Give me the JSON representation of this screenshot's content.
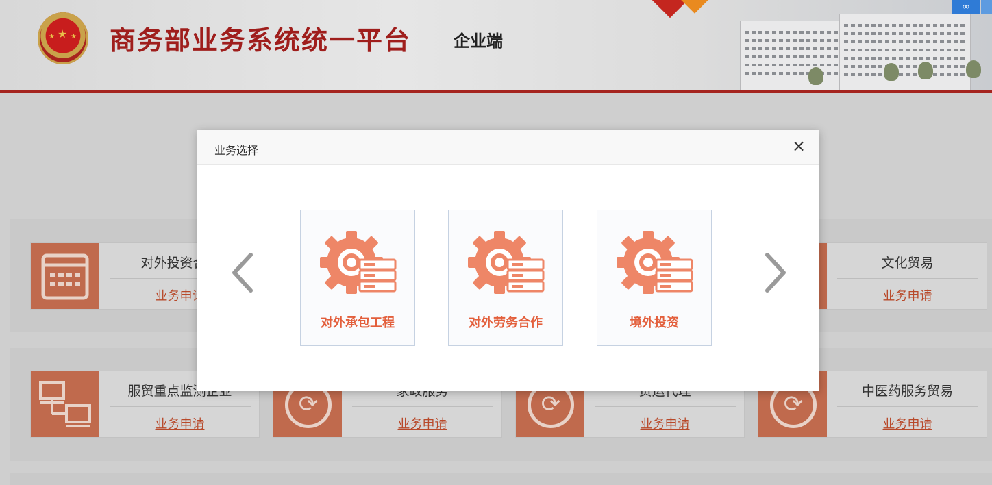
{
  "header": {
    "title": "商务部业务系统统一平台",
    "subtitle": "企业端",
    "badge_icon": "baidu-cloud-icon"
  },
  "background_cards": [
    {
      "name": "对外投资合作",
      "apply": "业务申请",
      "icon": "calendar-icon"
    },
    {
      "name": "文化贸易",
      "apply": "业务申请",
      "icon": "gear-icon"
    },
    {
      "name": "服贸重点监测企业",
      "apply": "业务申请",
      "icon": "network-icon"
    },
    {
      "name": "家政服务",
      "apply": "业务申请",
      "icon": "refresh-icon"
    },
    {
      "name": "货运代理",
      "apply": "业务申请",
      "icon": "refresh-icon"
    },
    {
      "name": "中医药服务贸易",
      "apply": "业务申请",
      "icon": "refresh-icon"
    }
  ],
  "modal": {
    "title": "业务选择",
    "close_icon": "×",
    "prev_icon": "chevron-left-icon",
    "next_icon": "chevron-right-icon",
    "options": [
      {
        "label": "对外承包工程",
        "icon": "gear-server-icon"
      },
      {
        "label": "对外劳务合作",
        "icon": "gear-server-icon"
      },
      {
        "label": "境外投资",
        "icon": "gear-server-icon"
      }
    ],
    "accent_color": "#ee8667"
  }
}
